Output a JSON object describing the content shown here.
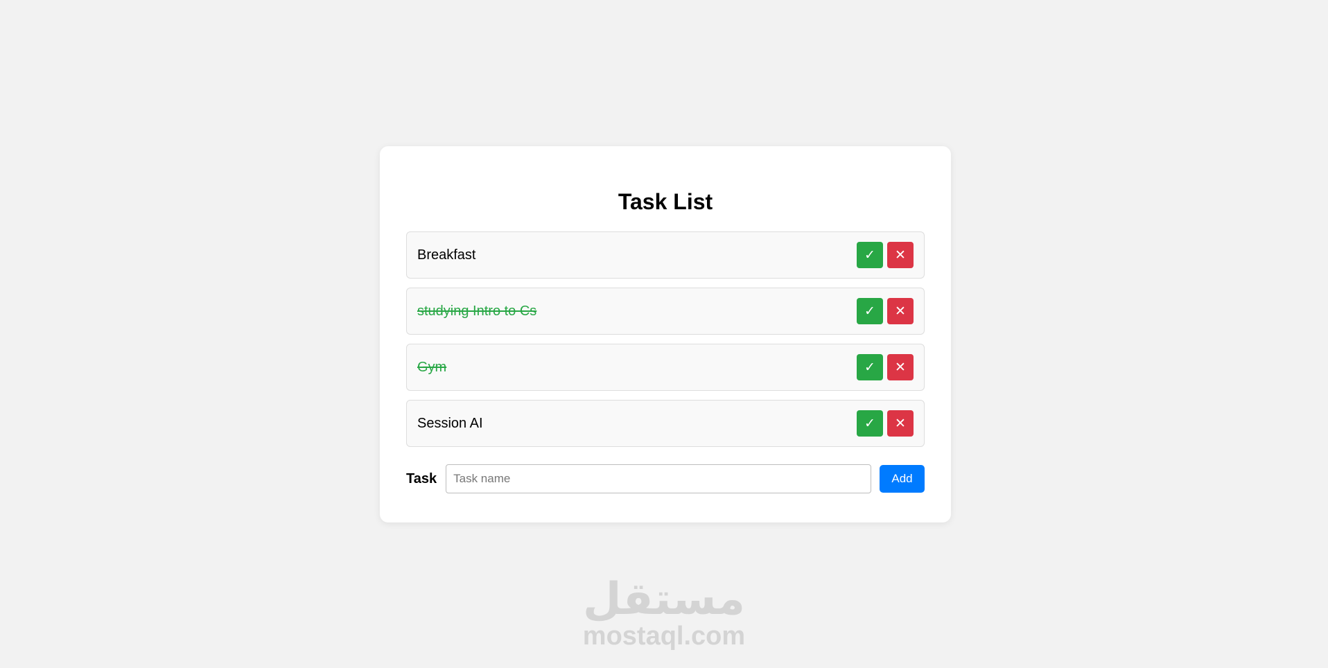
{
  "app": {
    "title": "Task List"
  },
  "tasks": [
    {
      "text": "Breakfast",
      "done": false,
      "complete_glyph": "✓",
      "delete_glyph": "✕"
    },
    {
      "text": "studying Intro to Cs",
      "done": true,
      "complete_glyph": "✓",
      "delete_glyph": "✕"
    },
    {
      "text": "Gym",
      "done": true,
      "complete_glyph": "✓",
      "delete_glyph": "✕"
    },
    {
      "text": "Session AI",
      "done": false,
      "complete_glyph": "✓",
      "delete_glyph": "✕"
    }
  ],
  "form": {
    "label": "Task",
    "input_placeholder": "Task name",
    "input_value": "",
    "add_label": "Add"
  },
  "watermark": {
    "arabic": "مستقل",
    "latin": "mostaql.com"
  },
  "colors": {
    "background": "#f2f2f2",
    "complete": "#28a745",
    "delete": "#dc3545",
    "primary": "#007bff",
    "done_text": "#28a745"
  },
  "icons": {
    "complete": "check-icon",
    "delete": "close-icon"
  }
}
